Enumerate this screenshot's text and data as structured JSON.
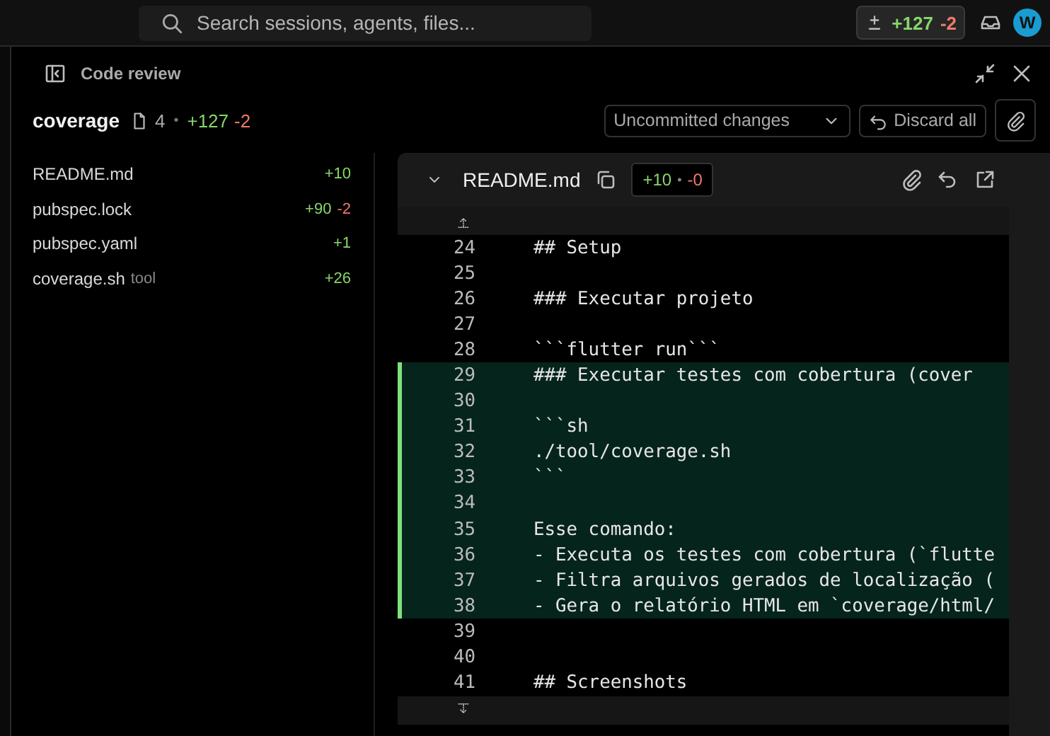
{
  "top_bar": {
    "search": {
      "placeholder": "Search sessions, agents, files..."
    },
    "changes": {
      "added": "+127",
      "removed": "-2"
    },
    "avatar": "W"
  },
  "panel": {
    "title": "Code review"
  },
  "summary": {
    "name": "coverage",
    "file_count": "4",
    "separator": "•",
    "added": "+127",
    "removed": "-2",
    "scope": "Uncommitted changes",
    "discard": "Discard all"
  },
  "files": [
    {
      "name": "README.md",
      "added": "+10"
    },
    {
      "name": "pubspec.lock",
      "added": "+90",
      "removed": "-2"
    },
    {
      "name": "pubspec.yaml",
      "added": "+1"
    },
    {
      "name": "coverage.sh",
      "tag": "tool",
      "added": "+26"
    }
  ],
  "diff": {
    "file": "README.md",
    "expanded": true,
    "added": "+10",
    "separator": "•",
    "removed": "-0",
    "lines": [
      {
        "number": "24",
        "text": "## Setup",
        "added": false
      },
      {
        "number": "25",
        "added": false
      },
      {
        "number": "26",
        "text": "### Executar projeto",
        "added": false
      },
      {
        "number": "27",
        "added": false
      },
      {
        "number": "28",
        "text": "```flutter run```",
        "added": false
      },
      {
        "number": "29",
        "text": "### Executar testes com cobertura (cover",
        "added": true
      },
      {
        "number": "30",
        "added": true
      },
      {
        "number": "31",
        "text": "```sh",
        "added": true
      },
      {
        "number": "32",
        "text": "./tool/coverage.sh",
        "added": true
      },
      {
        "number": "33",
        "text": "```",
        "added": true
      },
      {
        "number": "34",
        "added": true
      },
      {
        "number": "35",
        "text": "Esse comando:",
        "added": true
      },
      {
        "number": "36",
        "text": "- Executa os testes com cobertura (`flutte",
        "added": true
      },
      {
        "number": "37",
        "text": "- Filtra arquivos gerados de localização (",
        "added": true
      },
      {
        "number": "38",
        "text": "- Gera o relatório HTML em `coverage/html/",
        "added": true
      },
      {
        "number": "39",
        "added": false
      },
      {
        "number": "40",
        "added": false
      },
      {
        "number": "41",
        "text": "## Screenshots",
        "added": false
      }
    ]
  }
}
